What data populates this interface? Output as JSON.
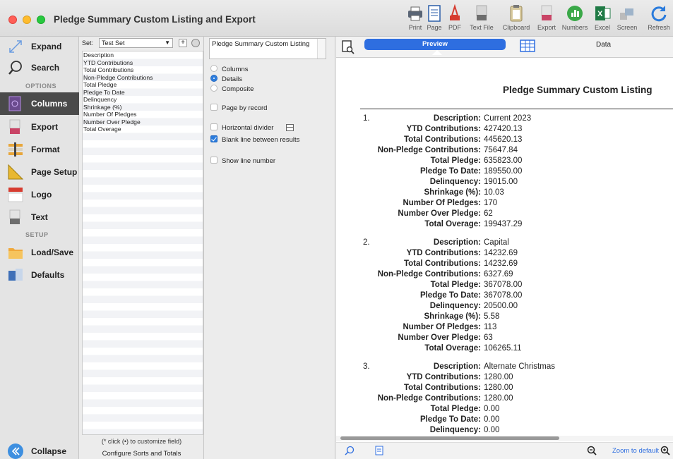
{
  "window": {
    "title": "Pledge Summary Custom Listing and Export"
  },
  "toolbar": {
    "items": [
      {
        "label": "Print",
        "icon": "printer-icon"
      },
      {
        "label": "Page",
        "icon": "page-icon"
      },
      {
        "label": "PDF",
        "icon": "pdf-icon"
      },
      {
        "label": "Text File",
        "icon": "text-file-icon"
      },
      {
        "label": "Clipboard",
        "icon": "clipboard-icon"
      },
      {
        "label": "Export",
        "icon": "csv-export-icon"
      },
      {
        "label": "Numbers",
        "icon": "numbers-icon"
      },
      {
        "label": "Excel",
        "icon": "excel-icon"
      },
      {
        "label": "Screen",
        "icon": "screen-icon"
      },
      {
        "label": "Refresh",
        "icon": "refresh-icon"
      }
    ]
  },
  "sidebar": {
    "expand": "Expand",
    "search": "Search",
    "options_header": "OPTIONS",
    "columns": "Columns",
    "export": "Export",
    "format": "Format",
    "page_setup": "Page Setup",
    "logo": "Logo",
    "text": "Text",
    "setup_header": "SETUP",
    "load_save": "Load/Save",
    "defaults": "Defaults",
    "collapse": "Collapse"
  },
  "fields": {
    "set_label": "Set:",
    "set_value": "Test Set",
    "add_symbol": "+",
    "items": [
      "Description",
      "YTD Contributions",
      "Total Contributions",
      "Non-Pledge Contributions",
      "Total Pledge",
      "Pledge To Date",
      "Delinquency",
      "Shrinkage (%)",
      "Number Of Pledges",
      "Number Over Pledge",
      "Total Overage"
    ],
    "note": "(* click (•) to customize field)",
    "config_button": "Configure Sorts and Totals"
  },
  "options": {
    "title_value": "Pledge Summary Custom Listing",
    "columns": "Columns",
    "details": "Details",
    "composite": "Composite",
    "page_by_record": "Page by record",
    "horizontal_divider": "Horizontal divider",
    "blank_line": "Blank line between results",
    "show_line_number": "Show line number"
  },
  "preview": {
    "tab_preview": "Preview",
    "tab_data": "Data",
    "report_title": "Pledge Summary Custom Listing",
    "zoom_label": "Zoom to default",
    "records": [
      {
        "num": "1.",
        "rows": [
          {
            "label": "Description:",
            "value": "Current 2023"
          },
          {
            "label": "YTD Contributions:",
            "value": "427420.13"
          },
          {
            "label": "Total Contributions:",
            "value": "445620.13"
          },
          {
            "label": "Non-Pledge Contributions:",
            "value": "75647.84"
          },
          {
            "label": "Total Pledge:",
            "value": "635823.00"
          },
          {
            "label": "Pledge To Date:",
            "value": "189550.00"
          },
          {
            "label": "Delinquency:",
            "value": "19015.00"
          },
          {
            "label": "Shrinkage (%):",
            "value": "10.03"
          },
          {
            "label": "Number Of Pledges:",
            "value": "170"
          },
          {
            "label": "Number Over Pledge:",
            "value": "62"
          },
          {
            "label": "Total Overage:",
            "value": "199437.29"
          }
        ]
      },
      {
        "num": "2.",
        "rows": [
          {
            "label": "Description:",
            "value": "Capital"
          },
          {
            "label": "YTD Contributions:",
            "value": "14232.69"
          },
          {
            "label": "Total Contributions:",
            "value": "14232.69"
          },
          {
            "label": "Non-Pledge Contributions:",
            "value": "6327.69"
          },
          {
            "label": "Total Pledge:",
            "value": "367078.00"
          },
          {
            "label": "Pledge To Date:",
            "value": "367078.00"
          },
          {
            "label": "Delinquency:",
            "value": "20500.00"
          },
          {
            "label": "Shrinkage (%):",
            "value": "5.58"
          },
          {
            "label": "Number Of Pledges:",
            "value": "113"
          },
          {
            "label": "Number Over Pledge:",
            "value": "63"
          },
          {
            "label": "Total Overage:",
            "value": "106265.11"
          }
        ]
      },
      {
        "num": "3.",
        "rows": [
          {
            "label": "Description:",
            "value": "Alternate Christmas"
          },
          {
            "label": "YTD Contributions:",
            "value": "1280.00"
          },
          {
            "label": "Total Contributions:",
            "value": "1280.00"
          },
          {
            "label": "Non-Pledge Contributions:",
            "value": "1280.00"
          },
          {
            "label": "Total Pledge:",
            "value": "0.00"
          },
          {
            "label": "Pledge To Date:",
            "value": "0.00"
          },
          {
            "label": "Delinquency:",
            "value": "0.00"
          }
        ]
      }
    ]
  },
  "colors": {
    "accent": "#2e6ee0",
    "sidebar_active": "#4a4a4a"
  }
}
